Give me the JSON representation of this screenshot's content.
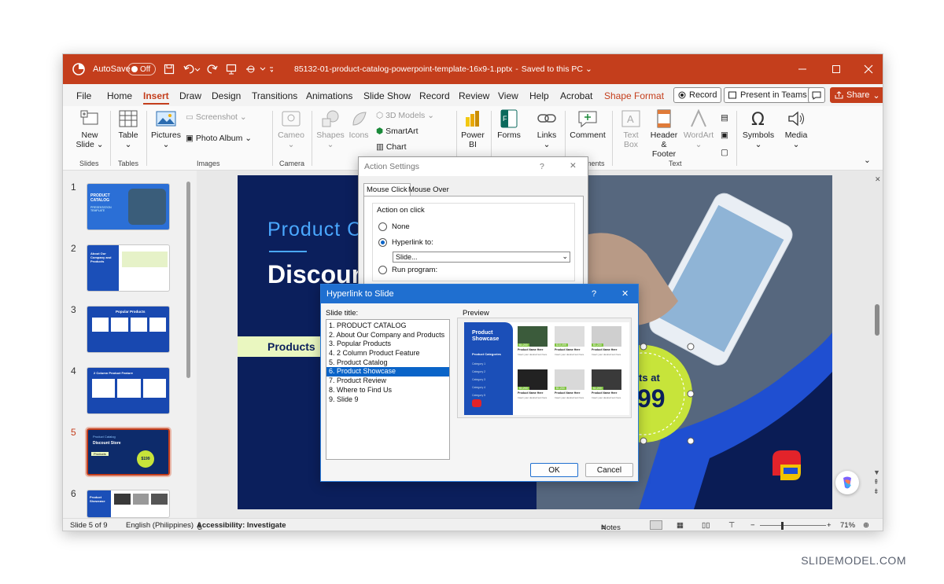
{
  "titlebar": {
    "autosave_label": "AutoSave",
    "autosave_state": "Off",
    "filename": "85132-01-product-catalog-powerpoint-template-16x9-1.pptx",
    "save_status": "Saved to this PC"
  },
  "menu": {
    "tabs": [
      "File",
      "Home",
      "Insert",
      "Draw",
      "Design",
      "Transitions",
      "Animations",
      "Slide Show",
      "Record",
      "Review",
      "View",
      "Help",
      "Acrobat",
      "Shape Format"
    ],
    "active_tab": "Insert",
    "record_label": "Record",
    "present_label": "Present in Teams",
    "share_label": "Share"
  },
  "ribbon": {
    "new_slide": "New Slide",
    "table": "Table",
    "pictures": "Pictures",
    "screenshot": "Screenshot",
    "photo_album": "Photo Album",
    "cameo": "Cameo",
    "shapes": "Shapes",
    "icons": "Icons",
    "models_3d": "3D Models",
    "smartart": "SmartArt",
    "chart": "Chart",
    "power_bi": "Power BI",
    "forms": "Forms",
    "links": "Links",
    "comment": "Comment",
    "text_box": "Text Box",
    "header_footer": "Header & Footer",
    "wordart": "WordArt",
    "symbols": "Symbols",
    "media": "Media",
    "groups": {
      "slides": "Slides",
      "tables": "Tables",
      "images": "Images",
      "camera": "Camera",
      "comments_partial": "ments",
      "text": "Text"
    }
  },
  "thumbnails": {
    "numbers": [
      "1",
      "2",
      "3",
      "4",
      "5",
      "6"
    ],
    "selected": "5",
    "t1": {
      "title": "PRODUCT CATALOG",
      "subtitle": "PRESENTATION TEMPLATE"
    },
    "t2": {
      "title": "About Our Company and Products"
    },
    "t3": {
      "title": "Popular Products"
    },
    "t4": {
      "title": "2 Column Product Feature"
    },
    "t5": {
      "title": "Product Catalog",
      "subtitle": "Discount Store",
      "tag": "Products",
      "price": "$199"
    },
    "t6": {
      "title": "Product Showcase"
    }
  },
  "slide": {
    "heading": "Product C",
    "subheading": "Discoun",
    "tag": "Products",
    "price_line1": "rts at",
    "price_line2": "99"
  },
  "action_settings": {
    "title": "Action Settings",
    "help": "?",
    "tabs": [
      "Mouse Click",
      "Mouse Over"
    ],
    "group": "Action on click",
    "opt_none": "None",
    "opt_hyperlink": "Hyperlink to:",
    "hyperlink_value": "Slide...",
    "opt_run": "Run program:"
  },
  "hyperlink_dialog": {
    "title": "Hyperlink to Slide",
    "help": "?",
    "slide_title_label": "Slide title:",
    "preview_label": "Preview",
    "slides": [
      "1. PRODUCT CATALOG",
      "2. About Our Company and Products",
      "3. Popular Products",
      "4. 2 Column Product Feature",
      "5. Product Catalog",
      "6. Product Showcase",
      "7. Product Review",
      "8. Where to  Find Us",
      "9. Slide 9"
    ],
    "selected_index": 5,
    "ok": "OK",
    "cancel": "Cancel",
    "preview": {
      "title": "Product Showcase",
      "categories_label": "Product Categories",
      "categories": [
        "Category 1",
        "Category 2",
        "Category 3",
        "Category 4",
        "Category 5"
      ],
      "item_name": "Product Name Here",
      "item_desc": "Insert your desired text here",
      "prices": [
        "$1,200",
        "$10,499",
        "$1,200",
        "$1,200",
        "$1,200",
        "$1,200"
      ]
    }
  },
  "status": {
    "slide_info": "Slide 5 of 9",
    "language": "English (Philippines)",
    "accessibility": "Accessibility: Investigate",
    "notes": "Notes",
    "zoom": "71%"
  },
  "watermark": "SLIDEMODEL.COM",
  "colors": {
    "accent": "#c43e1c",
    "slide_bg": "#0b1f5c",
    "lime": "#c7e43a",
    "select_blue": "#0a64c8"
  }
}
